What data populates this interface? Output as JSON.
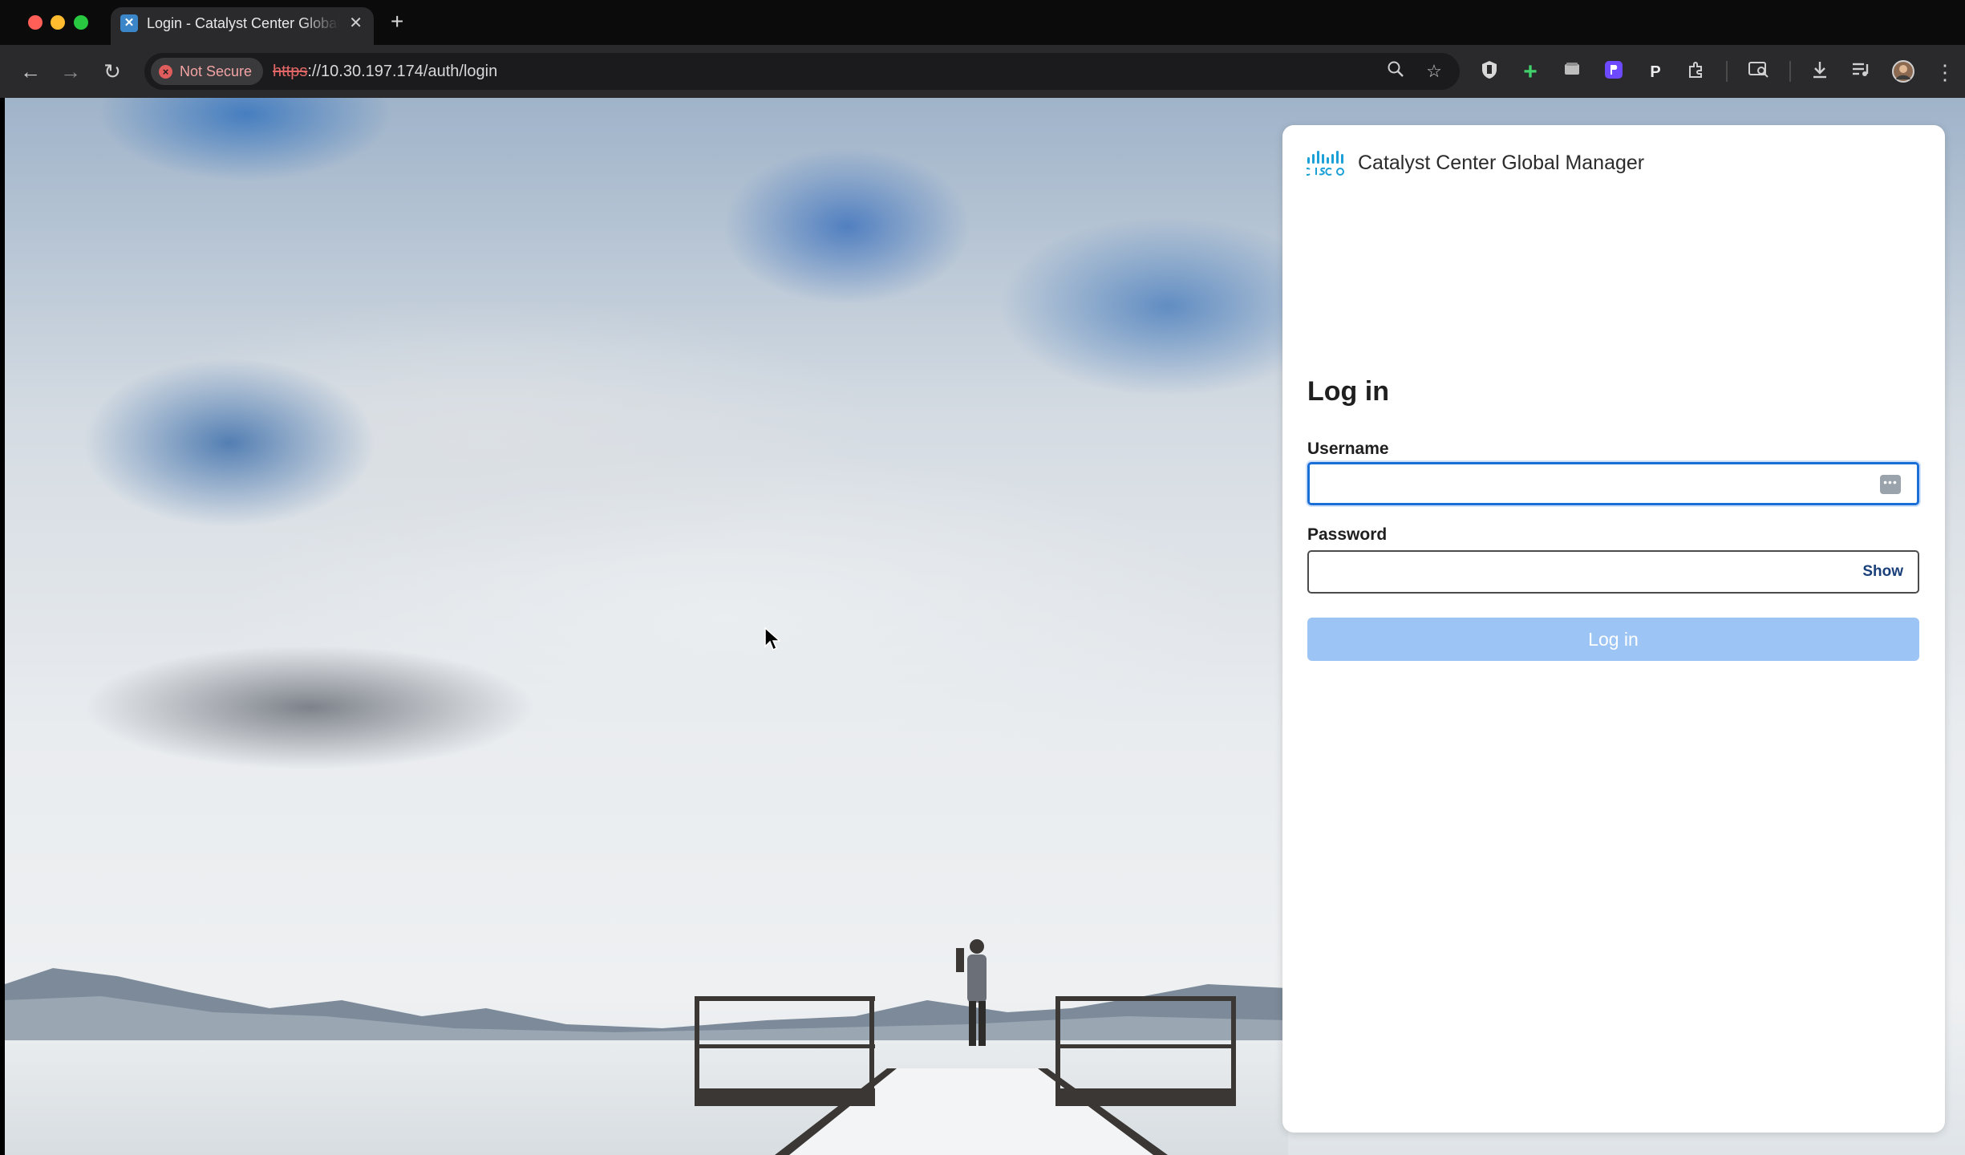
{
  "browser": {
    "tab": {
      "title": "Login - Catalyst Center Global Manager",
      "close_glyph": "✕",
      "favicon": "catalyst-favicon"
    },
    "new_tab_glyph": "+",
    "nav": {
      "back": "←",
      "forward": "→",
      "reload": "↻"
    },
    "security_label": "Not Secure",
    "url_scheme": "https",
    "url_rest": "://10.30.197.174/auth/login",
    "omnibox_icons": [
      "zoom-icon",
      "bookmark-star-icon"
    ],
    "extensions": [
      "shield-extension-icon",
      "plus-extension-icon",
      "wallet-extension-icon",
      "proton-extension-icon",
      "p-extension-icon",
      "puzzle-extensions-icon",
      "tab-search-icon",
      "download-icon",
      "media-queue-icon",
      "profile-avatar-icon",
      "menu-kebab-icon"
    ]
  },
  "login": {
    "brand_name": "Catalyst Center Global Manager",
    "heading": "Log in",
    "username_label": "Username",
    "username_value": "",
    "password_label": "Password",
    "password_value": "",
    "show_label": "Show",
    "submit_label": "Log in"
  },
  "colors": {
    "primary": "#1a6fd6",
    "submit_disabled": "#9cc4f4",
    "not_secure": "#e36767",
    "cisco_blue": "#1ba0d7"
  }
}
